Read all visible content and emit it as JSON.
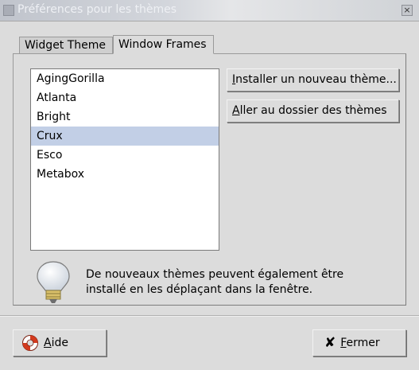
{
  "window": {
    "title": "Préférences pour les thèmes",
    "close_glyph": "×"
  },
  "tabs": [
    {
      "label": "Widget Theme",
      "active": false
    },
    {
      "label": "Window Frames",
      "active": true
    }
  ],
  "themes": {
    "items": [
      "AgingGorilla",
      "Atlanta",
      "Bright",
      "Crux",
      "Esco",
      "Metabox"
    ],
    "selected": "Crux"
  },
  "actions": {
    "install_mnemonic": "I",
    "install_rest": "nstaller un nouveau thème...",
    "folder_mnemonic": "A",
    "folder_rest": "ller au dossier des thèmes"
  },
  "info": {
    "line1": "De nouveaux thèmes peuvent également être",
    "line2": "installé en les déplaçant dans la fenêtre.",
    "icon": "lightbulb-icon"
  },
  "footer": {
    "help_mnemonic": "A",
    "help_rest": "ide",
    "help_icon": "lifebuoy-icon",
    "close_glyph": "✘",
    "close_mnemonic": "F",
    "close_rest": "ermer",
    "close_icon": "x-icon"
  },
  "colors": {
    "selection": "#c2cfe6",
    "dialog_bg": "#dcdcdc",
    "lifebuoy_red": "#d23a1e"
  }
}
